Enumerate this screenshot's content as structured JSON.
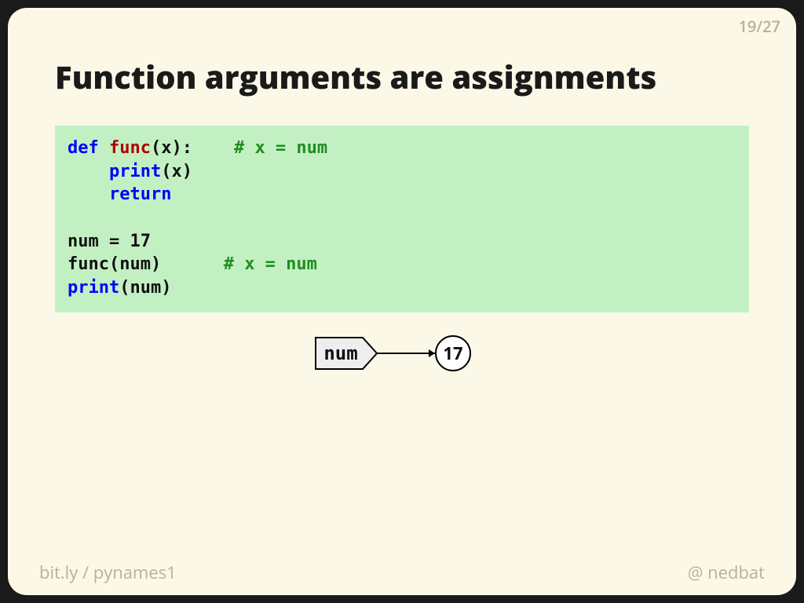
{
  "page": {
    "current": "19",
    "total": "27"
  },
  "title": "Function arguments are assignments",
  "code": {
    "l1_def": "def",
    "l1_func": "func",
    "l1_sig": "(x):",
    "l1_pad": "    ",
    "l1_cmt": "# x = num",
    "l2_pad": "    ",
    "l2_bi": "print",
    "l2_rest": "(x)",
    "l3_pad": "    ",
    "l3_kw": "return",
    "l5": "num = 17",
    "l6_call": "func(num)",
    "l6_pad": "      ",
    "l6_cmt": "# x = num",
    "l7_bi": "print",
    "l7_rest": "(num)"
  },
  "diagram": {
    "name": "num",
    "value": "17"
  },
  "footer": {
    "link_prefix": "bit.ly",
    "slash": "/",
    "link_path": "pynames1",
    "at": "@",
    "handle": "nedbat"
  }
}
